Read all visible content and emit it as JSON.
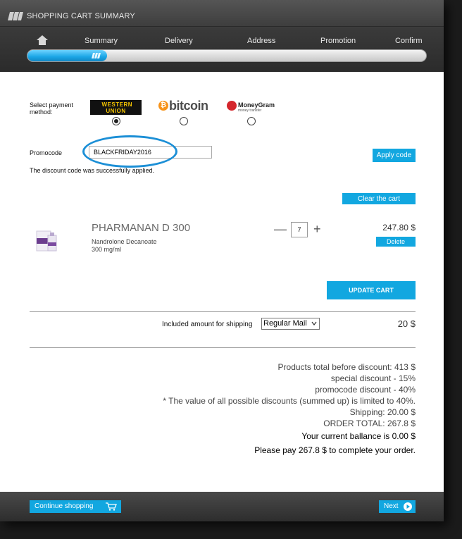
{
  "header": {
    "title": "SHOPPING CART SUMMARY",
    "steps": [
      "Summary",
      "Delivery",
      "Address",
      "Promotion",
      "Confirm"
    ],
    "progress_percent": 20
  },
  "payment": {
    "label": "Select payment method:",
    "options": [
      {
        "name": "WESTERN UNION",
        "selected": true
      },
      {
        "name": "bitcoin",
        "selected": false
      },
      {
        "name": "MoneyGram",
        "subtext": "money transfer",
        "selected": false
      }
    ]
  },
  "promo": {
    "label": "Promocode",
    "value": "BLACKFRIDAY2016",
    "apply_label": "Apply code",
    "message": "The discount code was successfully applied."
  },
  "cart": {
    "clear_label": "Clear the cart",
    "item": {
      "name": "PHARMANAN D 300",
      "substance": "Nandrolone Decanoate",
      "dosage": "300 mg/ml",
      "quantity": "7",
      "minus": "—",
      "plus": "+",
      "price": "247.80 $",
      "delete_label": "Delete"
    },
    "update_label": "UPDATE CART"
  },
  "shipping": {
    "label": "Included amount for shipping",
    "method": "Regular Mail",
    "amount": "20 $"
  },
  "summary": {
    "products_total": "Products total before discount: 413 $",
    "special_discount": "special discount - 15%",
    "promocode_discount": "promocode discount - 40%",
    "limit_note": "* The value of all possible discounts (summed up) is limited to 40%.",
    "shipping": "Shipping: 20.00 $",
    "order_total": "ORDER TOTAL: 267.8 $",
    "balance": "Your current ballance is 0.00 $",
    "please_pay": "Please pay 267.8 $ to complete your order."
  },
  "footer": {
    "continue_label": "Continue shopping",
    "next_label": "Next"
  },
  "colors": {
    "accent": "#12a7e0",
    "header_dark": "#3a3a3a"
  }
}
